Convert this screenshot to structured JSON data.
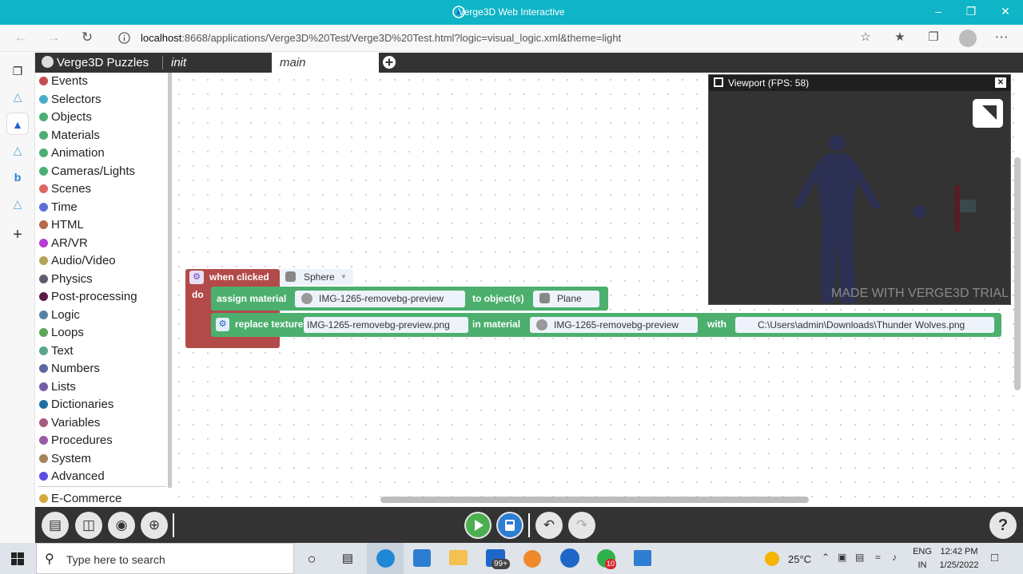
{
  "window": {
    "title": "Verge3D Web Interactive",
    "min_icon": "minimize-glyph",
    "max_icon": "maximize-glyph",
    "close_icon": "close-glyph"
  },
  "browser": {
    "url_host": "localhost",
    "url_rest": ":8668/applications/Verge3D%20Test/Verge3D%20Test.html?logic=visual_logic.xml&theme=light"
  },
  "editor": {
    "brand": "Verge3D Puzzles",
    "tabs": [
      {
        "label": "init"
      },
      {
        "label": "main"
      }
    ]
  },
  "toolbox": {
    "categories": [
      {
        "label": "Events",
        "color": "#c0504d"
      },
      {
        "label": "Selectors",
        "color": "#4bacc6"
      },
      {
        "label": "Objects",
        "color": "#4caf72"
      },
      {
        "label": "Materials",
        "color": "#4caf72"
      },
      {
        "label": "Animation",
        "color": "#4caf72"
      },
      {
        "label": "Cameras/Lights",
        "color": "#4caf72"
      },
      {
        "label": "Scenes",
        "color": "#e06666"
      },
      {
        "label": "Time",
        "color": "#5b6dd6"
      },
      {
        "label": "HTML",
        "color": "#b5694d"
      },
      {
        "label": "AR/VR",
        "color": "#b93ad6"
      },
      {
        "label": "Audio/Video",
        "color": "#b5a35a"
      },
      {
        "label": "Physics",
        "color": "#5a5f6b"
      },
      {
        "label": "Post-processing",
        "color": "#5c1a4a"
      },
      {
        "label": "Logic",
        "color": "#5b80a5"
      },
      {
        "label": "Loops",
        "color": "#5ba55b"
      },
      {
        "label": "Text",
        "color": "#5ba58c"
      },
      {
        "label": "Numbers",
        "color": "#5b67a5"
      },
      {
        "label": "Lists",
        "color": "#745ba5"
      },
      {
        "label": "Dictionaries",
        "color": "#1f6fa5"
      },
      {
        "label": "Variables",
        "color": "#a55b80"
      },
      {
        "label": "Procedures",
        "color": "#995ba5"
      },
      {
        "label": "System",
        "color": "#a5845b"
      },
      {
        "label": "Advanced",
        "color": "#5b4ce6"
      },
      {
        "label": "E-Commerce",
        "color": "#d4a83b"
      }
    ]
  },
  "viewport": {
    "title": "Viewport (FPS: 58)",
    "watermark": "MADE WITH VERGE3D TRIAL"
  },
  "puzzle": {
    "event": "when clicked",
    "event_object": "Sphere",
    "do": "do",
    "assign": "assign material",
    "assign_material": "IMG-1265-removebg-preview",
    "to_objects": "to object(s)",
    "assign_object": "Plane",
    "replace": "replace texture",
    "texture": "IMG-1265-removebg-preview.png",
    "in_material": "in material",
    "replace_material": "IMG-1265-removebg-preview",
    "with": "with",
    "path": "C:\\Users\\admin\\Downloads\\Thunder Wolves.png"
  },
  "taskbar": {
    "search_placeholder": "Type here to search",
    "weather": "25°C",
    "lang1": "ENG",
    "lang2": "IN",
    "time": "12:42 PM",
    "date": "1/25/2022",
    "mail_badge": "99+",
    "whatsapp_badge": "10"
  }
}
